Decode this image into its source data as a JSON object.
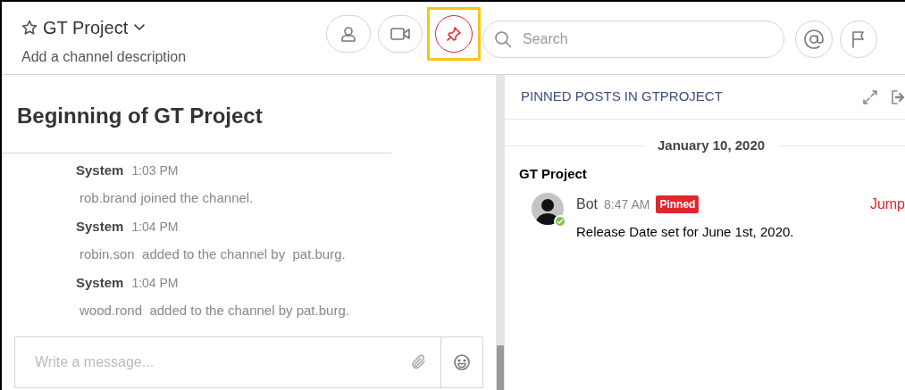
{
  "header": {
    "title": "GT Project",
    "description": "Add a channel description",
    "buttons": [
      {
        "kind": "members",
        "active": false,
        "highlighted": false
      },
      {
        "kind": "video",
        "active": false,
        "highlighted": false
      },
      {
        "kind": "pin",
        "active": true,
        "highlighted": true
      }
    ],
    "search": {
      "placeholder": "Search"
    },
    "right_buttons": [
      {
        "kind": "mention"
      },
      {
        "kind": "flag"
      }
    ]
  },
  "channel": {
    "heading": "Beginning of GT Project",
    "messages": [
      {
        "author": "System",
        "time": "1:03 PM",
        "text": "rob.brand joined the channel."
      },
      {
        "author": "System",
        "time": "1:04 PM",
        "text": "robin.son  added to the channel by  pat.burg."
      },
      {
        "author": "System",
        "time": "1:04 PM",
        "text": "wood.rond  added to the channel by pat.burg."
      }
    ],
    "composer": {
      "placeholder": "Write a message..."
    }
  },
  "pinned": {
    "title": "PINNED POSTS IN GTPROJECT",
    "date": "January 10, 2020",
    "channel": "GT Project",
    "posts": [
      {
        "author": "Bot",
        "time": "8:47 AM",
        "badge": "Pinned",
        "text": "Release Date set for June 1st, 2020.",
        "link": "Jump",
        "online": true
      }
    ]
  }
}
